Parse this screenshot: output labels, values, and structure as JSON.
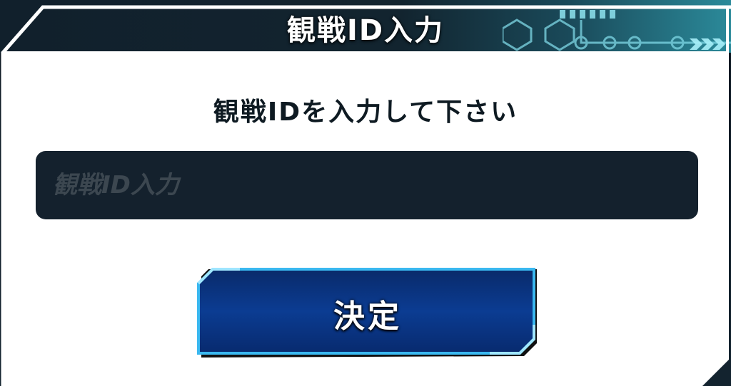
{
  "dialog": {
    "title": "観戦ID入力",
    "prompt": "観戦IDを入力して下さい",
    "input": {
      "placeholder": "観戦ID入力",
      "value": ""
    },
    "confirm_label": "決定"
  },
  "colors": {
    "panel_bg": "#ffffff",
    "header_bg": "#11202c",
    "input_bg": "#14212d",
    "button_bg": "#0b3a8a",
    "button_border": "#3ab8f0",
    "accent_teal": "#2b8a9a"
  },
  "icons": {
    "header_decoration": "circuit-pattern-icon",
    "header_arrows": "triple-chevron-right-icon"
  }
}
